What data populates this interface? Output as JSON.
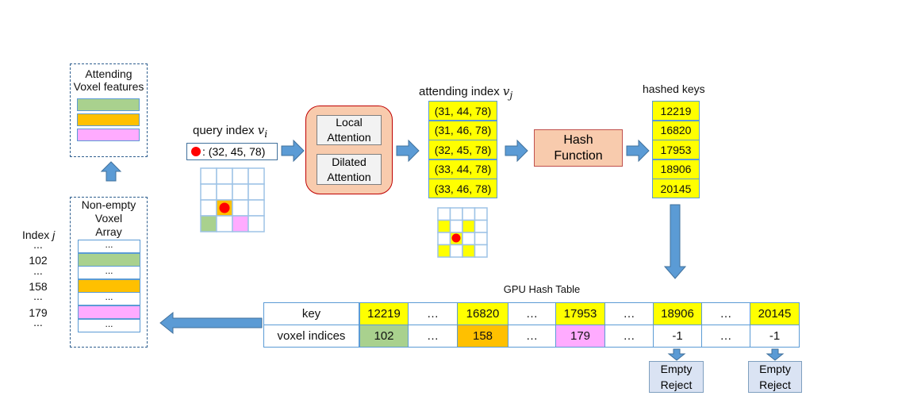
{
  "colors": {
    "green": "#a9d18e",
    "orange": "#ffc000",
    "pink": "#ffabff",
    "yellow": "#ffff00",
    "arrow": "#5b9bd5",
    "attention_fill": "#f8cbad",
    "attention_stroke": "#c00000",
    "query_dot": "#ff0000"
  },
  "attending_features": {
    "title_line1": "Attending",
    "title_line2": "Voxel features"
  },
  "voxel_array": {
    "title_line1": "Non-empty",
    "title_line2": "Voxel",
    "title_line3": "Array",
    "rows": [
      "...",
      "",
      "...",
      "",
      "...",
      "",
      "..."
    ]
  },
  "index_labels": {
    "title": "Index",
    "var": "j",
    "items": [
      "...",
      "102",
      "...",
      "158",
      "...",
      "179",
      "..."
    ]
  },
  "query": {
    "label": "query index",
    "var": "v",
    "sub": "i",
    "value": ": (32, 45, 78)"
  },
  "attention": {
    "local": "Local Attention",
    "dilated": "Dilated Attention"
  },
  "attending_index": {
    "label": "attending index",
    "var": "v",
    "sub": "j",
    "values": [
      "(31, 44, 78)",
      "(31, 46, 78)",
      "(32, 45, 78)",
      "(33, 44, 78)",
      "(33, 46, 78)"
    ]
  },
  "hash_function": {
    "label": "Hash Function"
  },
  "hashed_keys": {
    "label": "hashed keys",
    "values": [
      "12219",
      "16820",
      "17953",
      "18906",
      "20145"
    ]
  },
  "hash_table": {
    "title": "GPU Hash Table",
    "key_header": "key",
    "value_header": "voxel indices",
    "keys": [
      "12219",
      "…",
      "16820",
      "…",
      "17953",
      "…",
      "18906",
      "…",
      "20145"
    ],
    "values": [
      "102",
      "…",
      "158",
      "…",
      "179",
      "…",
      "-1",
      "…",
      "-1"
    ]
  },
  "empty_reject": [
    "Empty Reject",
    "Empty Reject"
  ]
}
